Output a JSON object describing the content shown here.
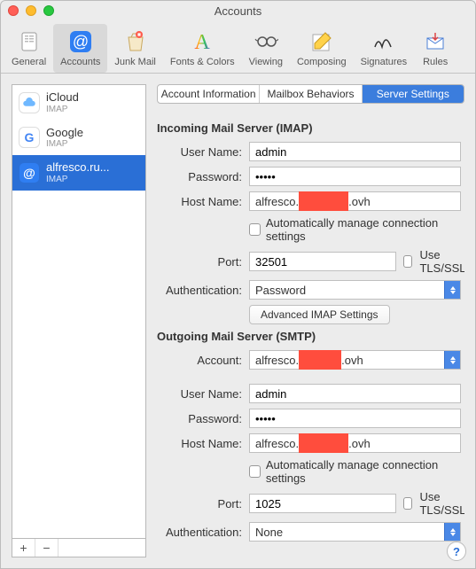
{
  "window": {
    "title": "Accounts"
  },
  "toolbar": [
    {
      "id": "general",
      "label": "General"
    },
    {
      "id": "accounts",
      "label": "Accounts"
    },
    {
      "id": "junk",
      "label": "Junk Mail"
    },
    {
      "id": "fonts",
      "label": "Fonts & Colors"
    },
    {
      "id": "viewing",
      "label": "Viewing"
    },
    {
      "id": "composing",
      "label": "Composing"
    },
    {
      "id": "signatures",
      "label": "Signatures"
    },
    {
      "id": "rules",
      "label": "Rules"
    }
  ],
  "selected_toolbar": "accounts",
  "accounts": [
    {
      "id": "icloud",
      "name": "iCloud",
      "sub": "IMAP",
      "icon": "cloud"
    },
    {
      "id": "google",
      "name": "Google",
      "sub": "IMAP",
      "icon": "google"
    },
    {
      "id": "alfresco",
      "name": "alfresco.ru...",
      "sub": "IMAP",
      "icon": "at"
    }
  ],
  "selected_account": "alfresco",
  "tabs": {
    "info": "Account Information",
    "mbox": "Mailbox Behaviors",
    "server": "Server Settings"
  },
  "selected_tab": "server",
  "incoming": {
    "heading": "Incoming Mail Server (IMAP)",
    "labels": {
      "user": "User Name:",
      "password": "Password:",
      "host": "Host Name:",
      "auto": "Automatically manage connection settings",
      "port": "Port:",
      "tls": "Use TLS/SSL",
      "auth": "Authentication:",
      "advanced": "Advanced IMAP Settings"
    },
    "user": "admin",
    "password": "•••••",
    "host_prefix": "alfresco.",
    "host_suffix": ".ovh",
    "port": "32501",
    "auth": "Password"
  },
  "outgoing": {
    "heading": "Outgoing Mail Server (SMTP)",
    "labels": {
      "account": "Account:",
      "user": "User Name:",
      "password": "Password:",
      "host": "Host Name:",
      "auto": "Automatically manage connection settings",
      "port": "Port:",
      "tls": "Use TLS/SSL",
      "auth": "Authentication:"
    },
    "account_prefix": "alfresco.",
    "account_suffix": ".ovh",
    "user": "admin",
    "password": "•••••",
    "host_prefix": "alfresco.",
    "host_suffix": ".ovh",
    "port": "1025",
    "auth": "None"
  },
  "footer": {
    "add": "+",
    "remove": "−",
    "help": "?"
  }
}
